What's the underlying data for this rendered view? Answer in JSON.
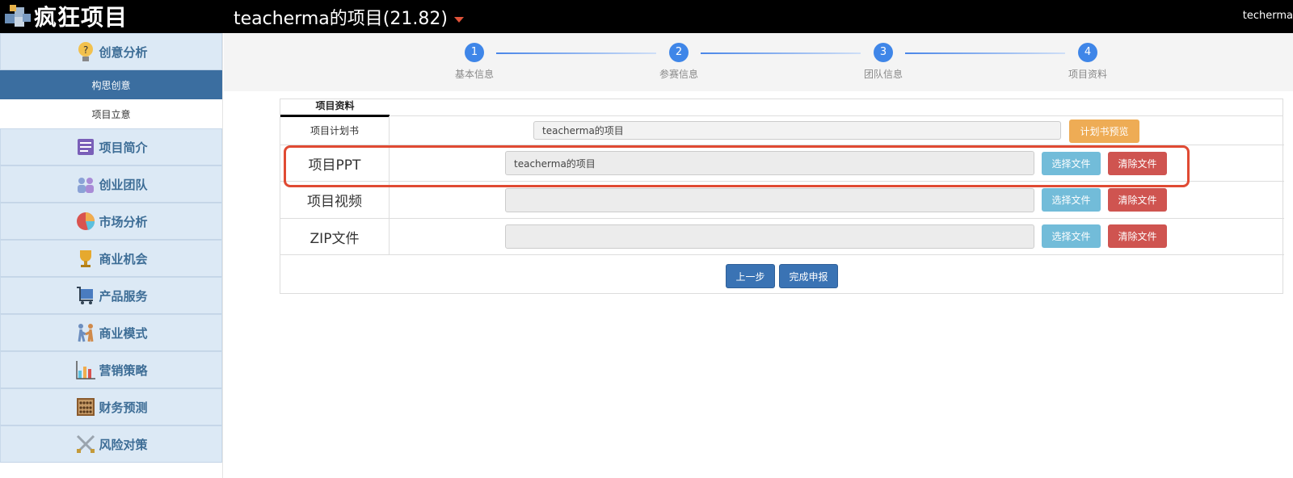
{
  "app": {
    "logo_text": "疯狂项目",
    "project_title": "teacherma的项目(21.82)",
    "user_name": "techerma"
  },
  "sidebar": {
    "header": "创意分析",
    "sub_items": [
      "构思创意",
      "项目立意"
    ],
    "items": [
      {
        "label": "项目简介",
        "icon": "notebook-icon"
      },
      {
        "label": "创业团队",
        "icon": "team-icon"
      },
      {
        "label": "市场分析",
        "icon": "pie-chart-icon"
      },
      {
        "label": "商业机会",
        "icon": "trophy-icon"
      },
      {
        "label": "产品服务",
        "icon": "cart-icon"
      },
      {
        "label": "商业模式",
        "icon": "handshake-icon"
      },
      {
        "label": "营销策略",
        "icon": "bar-chart-icon"
      },
      {
        "label": "财务预测",
        "icon": "abacus-icon"
      },
      {
        "label": "风险对策",
        "icon": "swords-icon"
      }
    ]
  },
  "steps": [
    {
      "num": "1",
      "label": "基本信息"
    },
    {
      "num": "2",
      "label": "参赛信息"
    },
    {
      "num": "3",
      "label": "团队信息"
    },
    {
      "num": "4",
      "label": "项目资料"
    }
  ],
  "panel": {
    "tab": "项目资料",
    "rows": [
      {
        "label": "项目计划书",
        "value": "teacherma的项目",
        "button": "计划书预览"
      },
      {
        "label": "项目PPT",
        "value": "teacherma的项目",
        "choose": "选择文件",
        "clear": "清除文件"
      },
      {
        "label": "项目视频",
        "value": "",
        "choose": "选择文件",
        "clear": "清除文件"
      },
      {
        "label": "ZIP文件",
        "value": "",
        "choose": "选择文件",
        "clear": "清除文件"
      }
    ],
    "prev_button": "上一步",
    "submit_button": "完成申报"
  },
  "colors": {
    "accent": "#3f86e8",
    "highlight": "#e04a33",
    "sidebar_active": "#3b6ea0"
  }
}
